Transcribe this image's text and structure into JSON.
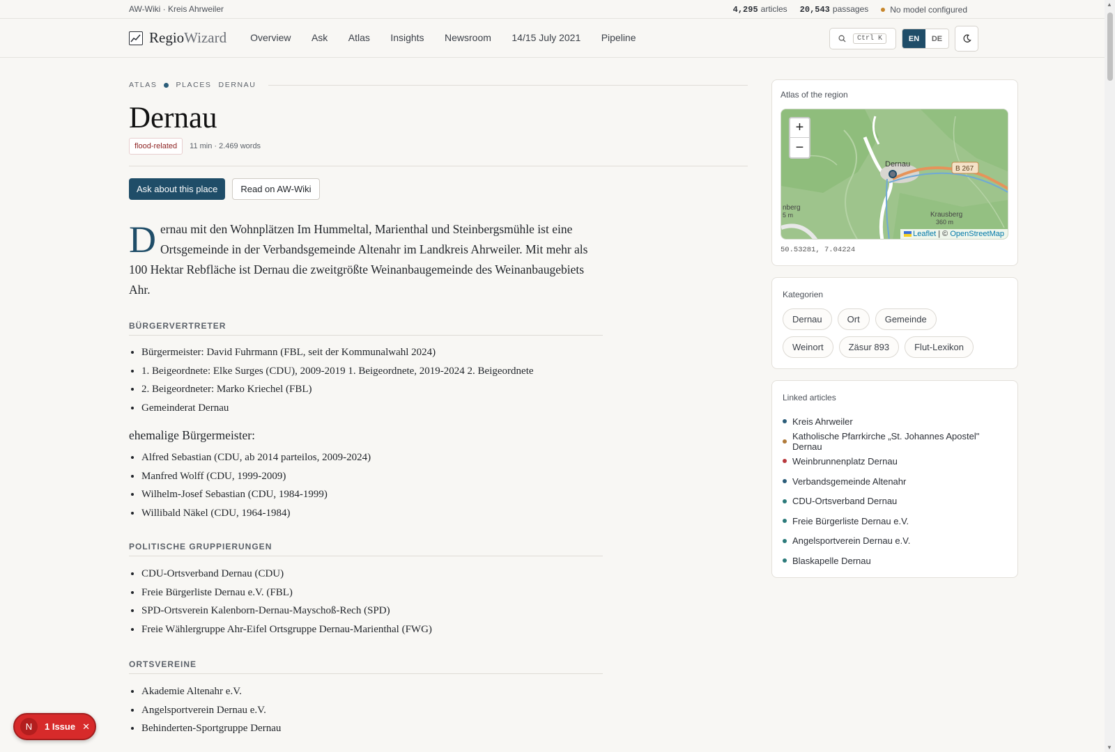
{
  "topbar": {
    "site": "AW-Wiki · Kreis Ahrweiler",
    "articles_count": "4,295",
    "articles_label": "articles",
    "passages_count": "20,543",
    "passages_label": "passages",
    "model_status": "No model configured"
  },
  "nav": {
    "brand_a": "Regio",
    "brand_b": "Wizard",
    "items": [
      "Overview",
      "Ask",
      "Atlas",
      "Insights",
      "Newsroom",
      "14/15 July 2021",
      "Pipeline"
    ],
    "search_kbd": "Ctrl K",
    "lang_en": "EN",
    "lang_de": "DE"
  },
  "breadcrumb": {
    "a": "ATLAS",
    "b": "PLACES",
    "c": "DERNAU"
  },
  "page": {
    "title": "Dernau",
    "tag": "flood-related",
    "meta": "11 min · 2.469 words",
    "ask_button": "Ask about this place",
    "read_button": "Read on AW-Wiki"
  },
  "article": {
    "lead_initial": "D",
    "lead_rest": "ernau mit den Wohnplätzen Im Hummeltal, Marienthal und Steinbergsmühle ist eine Ortsgemeinde in der Verbandsgemeinde Altenahr im Landkreis Ahrweiler. Mit mehr als 100 Hektar Rebfläche ist Dernau die zweitgrößte Weinanbaugemeinde des Weinanbaugebiets Ahr.",
    "sec1": "BÜRGERVERTRETER",
    "list1": [
      "Bürgermeister: David Fuhrmann (FBL, seit der Kommunalwahl 2024)",
      "1. Beigeordnete: Elke Surges (CDU), 2009-2019 1. Beigeordnete, 2019-2024 2. Beigeordnete",
      "2. Beigeordneter: Marko Kriechel (FBL)",
      "Gemeinderat Dernau"
    ],
    "sub1": "ehemalige Bürgermeister:",
    "list2": [
      "Alfred Sebastian (CDU, ab 2014 parteilos, 2009-2024)",
      "Manfred Wolff (CDU, 1999-2009)",
      "Wilhelm-Josef Sebastian (CDU, 1984-1999)",
      "Willibald Näkel (CDU, 1964-1984)"
    ],
    "sec2": "POLITISCHE GRUPPIERUNGEN",
    "list3": [
      "CDU-Ortsverband Dernau (CDU)",
      "Freie Bürgerliste Dernau e.V. (FBL)",
      "SPD-Ortsverein Kalenborn-Dernau-Mayschoß-Rech (SPD)",
      "Freie Wählergruppe Ahr-Eifel Ortsgruppe Dernau-Marienthal (FWG)"
    ],
    "sec3": "ORTSVEREINE",
    "list4": [
      "Akademie Altenahr e.V.",
      "Angelsportverein Dernau e.V.",
      "Behinderten-Sportgruppe Dernau"
    ]
  },
  "atlas": {
    "title": "Atlas of the region",
    "zoom_in": "+",
    "zoom_out": "−",
    "place_label": "Dernau",
    "road_label": "B 267",
    "hill_label": "Krausberg",
    "hill_height": "360 m",
    "left_label": "nberg",
    "left_sub": "5 m",
    "attrib_leaflet": "Leaflet",
    "attrib_sep": "| ©",
    "attrib_osm": "OpenStreetMap",
    "coords": "50.53281, 7.04224"
  },
  "categories": {
    "title": "Kategorien",
    "items": [
      "Dernau",
      "Ort",
      "Gemeinde",
      "Weinort",
      "Zäsur 893",
      "Flut-Lexikon"
    ]
  },
  "linked": {
    "title": "Linked articles",
    "items": [
      "Kreis Ahrweiler",
      "Katholische Pfarrkirche „St. Johannes Apostel\" Dernau",
      "Weinbrunnenplatz Dernau",
      "Verbandsgemeinde Altenahr",
      "CDU-Ortsverband Dernau",
      "Freie Bürgerliste Dernau e.V.",
      "Angelsportverein Dernau e.V.",
      "Blaskapelle Dernau"
    ],
    "bullet_colors": [
      "#2b5d79",
      "#b07a3a",
      "#b8383d",
      "#2b5d79",
      "#2b7a7a",
      "#2b7a7a",
      "#2b7a7a",
      "#2b7a7a"
    ]
  },
  "issue": {
    "avatar": "N",
    "label": "1 Issue",
    "close": "✕"
  },
  "colors": {
    "accent": "#1f4d68",
    "danger": "#d72a2a",
    "tag": "#8e2424"
  }
}
